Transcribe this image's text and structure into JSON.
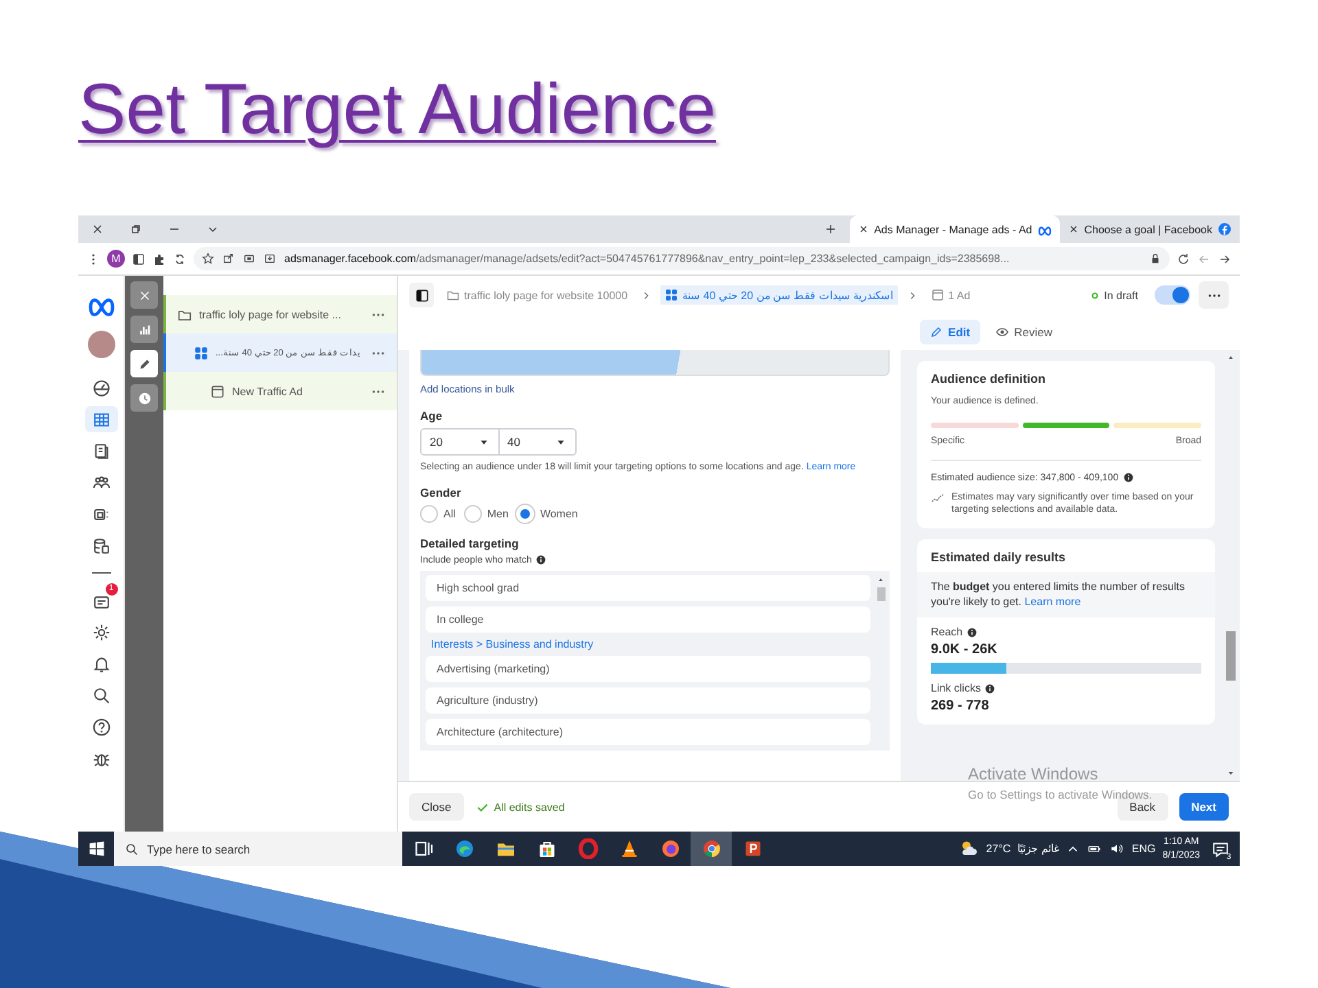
{
  "slide": {
    "title": "Set Target Audience"
  },
  "browser": {
    "tabs": [
      {
        "title": "Ads Manager - Manage ads - Ad",
        "selected": true
      },
      {
        "title": "Choose a goal | Facebook",
        "selected": false
      }
    ],
    "profile_initial": "M",
    "address": {
      "host": "adsmanager.facebook.com",
      "path": "/adsmanager/manage/adsets/edit?act=504745761777896&nav_entry_point=lep_233&selected_campaign_ids=2385698..."
    }
  },
  "nav_rail": {
    "items": [
      {
        "kind": "gauge",
        "selected": false
      },
      {
        "kind": "table",
        "selected": true
      },
      {
        "kind": "pages",
        "selected": false
      },
      {
        "kind": "people",
        "selected": false
      },
      {
        "kind": "creative",
        "selected": false
      },
      {
        "kind": "database",
        "selected": false
      },
      {
        "kind": "divider",
        "selected": false
      },
      {
        "kind": "inbox",
        "selected": false,
        "badge": "1"
      },
      {
        "kind": "gear",
        "selected": false
      },
      {
        "kind": "bell",
        "selected": false
      },
      {
        "kind": "search",
        "selected": false
      },
      {
        "kind": "help",
        "selected": false
      },
      {
        "kind": "bug",
        "selected": false
      }
    ]
  },
  "tool_strip": {
    "items": [
      {
        "kind": "close",
        "selected": false
      },
      {
        "kind": "chart",
        "selected": false
      },
      {
        "kind": "pencil",
        "selected": true
      },
      {
        "kind": "clock",
        "selected": false
      }
    ]
  },
  "tree": {
    "items": [
      {
        "kind": "campaign",
        "label": "traffic loly page for website ...",
        "selected": false,
        "children": [
          {
            "kind": "adset",
            "label": "يدات فقط سن من 20 حتي 40 سنة...",
            "selected": true,
            "children": [
              {
                "kind": "ad",
                "label": "New Traffic Ad",
                "selected": false
              }
            ]
          }
        ]
      }
    ]
  },
  "header": {
    "breadcrumbs": [
      {
        "kind": "campaign",
        "label": "traffic loly page for website 10000",
        "selected": false
      },
      {
        "kind": "adset",
        "label": "اسكندرية سيدات فقط سن من 20 حتي 40 سنة",
        "selected": true
      },
      {
        "kind": "ad",
        "label": "1 Ad",
        "selected": false
      }
    ],
    "status": "In draft",
    "toggle_on": true,
    "modes": [
      {
        "kind": "edit",
        "label": "Edit",
        "selected": true
      },
      {
        "kind": "review",
        "label": "Review",
        "selected": false
      }
    ]
  },
  "form": {
    "bulk_link": "Add locations in bulk",
    "age": {
      "label": "Age",
      "min": "20",
      "max": "40",
      "hint": "Selecting an audience under 18 will limit your targeting options to some locations and age.",
      "hint_link": "Learn more"
    },
    "gender": {
      "label": "Gender",
      "options": [
        {
          "label": "All",
          "selected": false
        },
        {
          "label": "Men",
          "selected": false
        },
        {
          "label": "Women",
          "selected": true
        }
      ]
    },
    "detailed_targeting": {
      "title": "Detailed targeting",
      "subtitle": "Include people who match",
      "items": [
        {
          "kind": "option",
          "label": "High school grad"
        },
        {
          "kind": "option",
          "label": "In college"
        },
        {
          "kind": "category",
          "label": "Interests > Business and industry"
        },
        {
          "kind": "option",
          "label": "Advertising (marketing)"
        },
        {
          "kind": "option",
          "label": "Agriculture (industry)"
        },
        {
          "kind": "option",
          "label": "Architecture (architecture)"
        }
      ]
    }
  },
  "audience": {
    "title": "Audience definition",
    "status": "Your audience is defined.",
    "meter": [
      {
        "selected": false
      },
      {
        "selected": true
      },
      {
        "selected": false
      }
    ],
    "low_label": "Specific",
    "high_label": "Broad",
    "size": "Estimated audience size: 347,800 - 409,100",
    "note": "Estimates may vary significantly over time based on your targeting selections and available data."
  },
  "results": {
    "title": "Estimated daily results",
    "notice": "The **budget** you entered limits the number of results you're likely to get.",
    "notice_link": "Learn more",
    "metrics": [
      {
        "label": "Reach",
        "value": "9.0K - 26K",
        "level": 0.28
      },
      {
        "label": "Link clicks",
        "value": "269 - 778"
      }
    ]
  },
  "footer": {
    "close": "Close",
    "saved": "All edits saved",
    "back": "Back",
    "next": "Next"
  },
  "os_notice": {
    "title": "Activate Windows",
    "subtitle": "Go to Settings to activate Windows."
  },
  "taskbar": {
    "search_placeholder": "Type here to search",
    "apps": [
      {
        "kind": "taskview",
        "selected": false
      },
      {
        "kind": "edge",
        "selected": false
      },
      {
        "kind": "explorer",
        "selected": false
      },
      {
        "kind": "store",
        "selected": false
      },
      {
        "kind": "opera",
        "selected": false
      },
      {
        "kind": "vlc",
        "selected": false
      },
      {
        "kind": "firefox",
        "selected": false
      },
      {
        "kind": "chrome",
        "selected": true
      },
      {
        "kind": "powerpoint",
        "selected": false
      }
    ],
    "temperature": "27°C",
    "weather": "غائم جزئيًا",
    "language": "ENG",
    "time": "1:10 AM",
    "date": "8/1/2023",
    "notifications": "3"
  }
}
